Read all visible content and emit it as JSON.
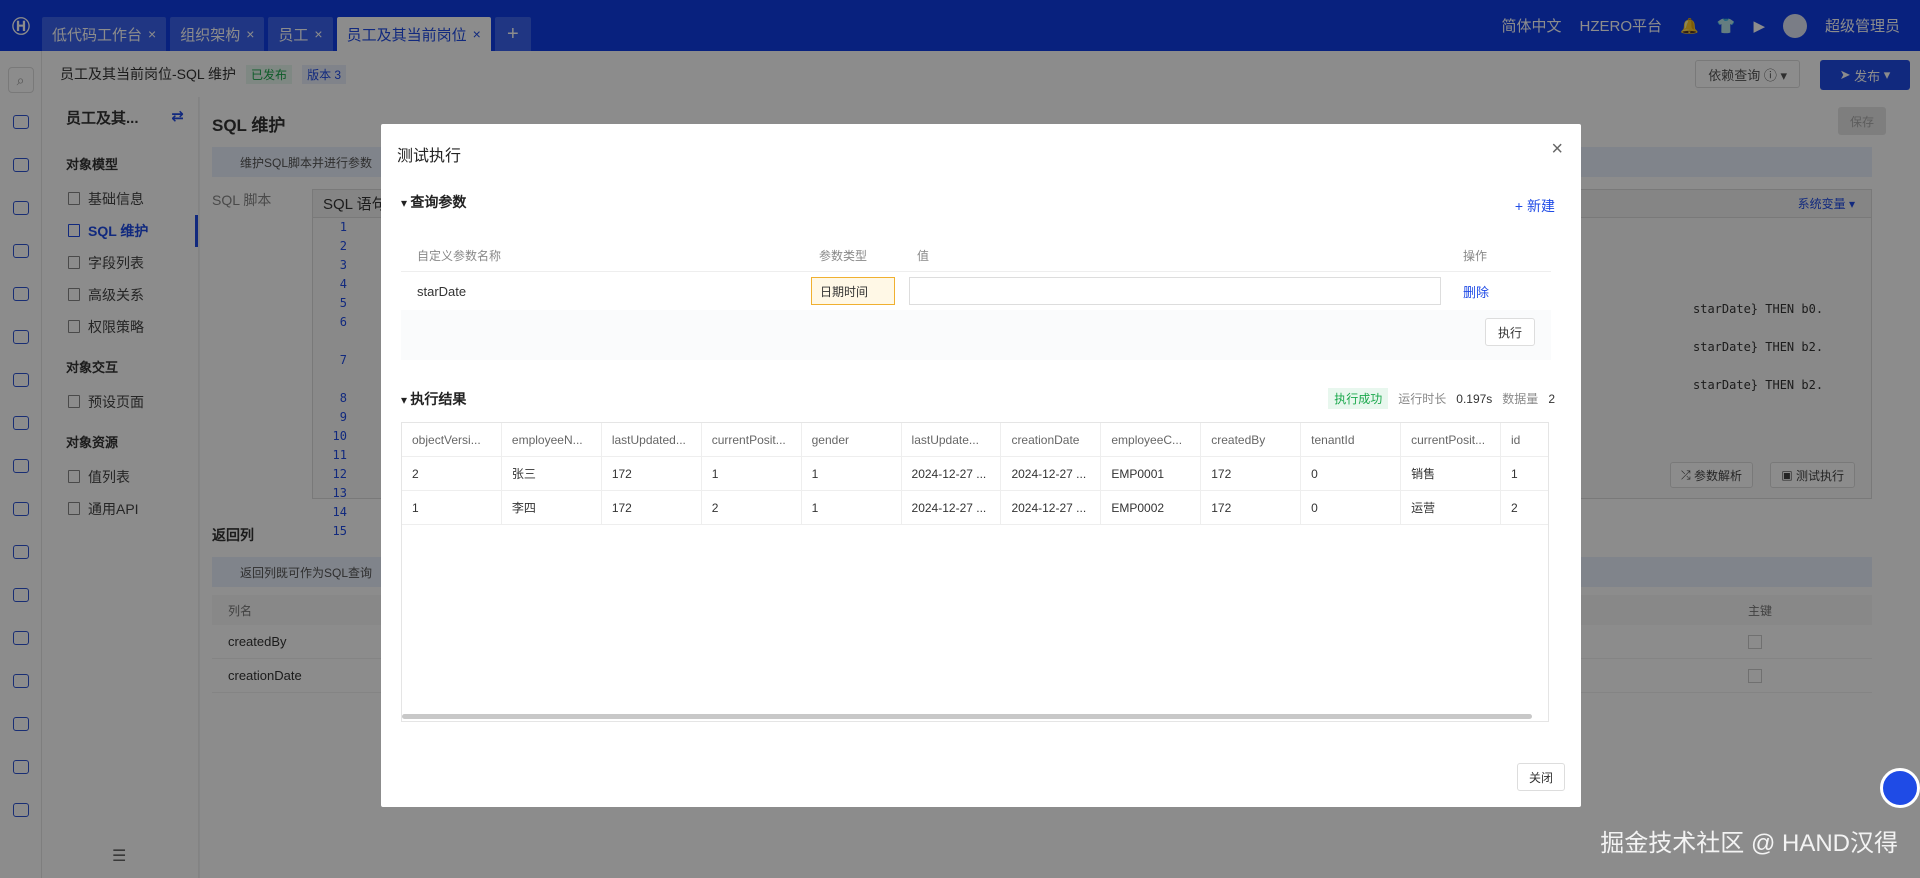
{
  "topbar": {
    "logo": "Ⓗ",
    "tabs": [
      {
        "label": "低代码工作台",
        "active": false
      },
      {
        "label": "组织架构",
        "active": false
      },
      {
        "label": "员工",
        "active": false
      },
      {
        "label": "员工及其当前岗位",
        "active": true
      }
    ],
    "add_tab": "+",
    "close": "×",
    "language": "简体中文",
    "platform": "HZERO平台",
    "user": "超级管理员"
  },
  "header": {
    "title": "员工及其当前岗位-SQL 维护",
    "status_tag": "已发布",
    "version_tag": "版本 3",
    "dep_query": "依赖查询",
    "publish": "发布"
  },
  "leftnav": {
    "title": "员工及其...",
    "groups": [
      {
        "label": "对象模型",
        "items": [
          "基础信息",
          "SQL 维护",
          "字段列表",
          "高级关系",
          "权限策略"
        ]
      },
      {
        "label": "对象交互",
        "items": [
          "预设页面"
        ]
      },
      {
        "label": "对象资源",
        "items": [
          "值列表",
          "通用API"
        ]
      }
    ]
  },
  "main": {
    "title": "SQL 维护",
    "save": "保存",
    "info": "维护SQL脚本并进行参数",
    "sql_label": "SQL 脚本",
    "editor_title": "SQL 语句",
    "sys_var": "系统变量",
    "lines": [
      "1",
      "2",
      "3",
      "4",
      "5",
      "6",
      "7",
      "8",
      "9",
      "10",
      "11",
      "12",
      "13",
      "14",
      "15"
    ],
    "code_frags": [
      "starDate} THEN b0.",
      "starDate} THEN b2.",
      "starDate} THEN b2."
    ],
    "parse_btn": "参数解析",
    "test_btn": "测试执行",
    "return_title": "返回列",
    "return_info": "返回列既可作为SQL查询",
    "return_col_head": "列名",
    "return_pk_head": "主键",
    "return_rows": [
      "createdBy",
      "creationDate"
    ]
  },
  "modal": {
    "title": "测试执行",
    "query_section": "查询参数",
    "new_link": "+ 新建",
    "param_headers": [
      "自定义参数名称",
      "参数类型",
      "值",
      "操作"
    ],
    "param_row": {
      "name": "starDate",
      "type": "日期时间",
      "value": "",
      "action": "删除"
    },
    "execute": "执行",
    "result_section": "执行结果",
    "status": "执行成功",
    "runtime_label": "运行时长",
    "runtime": "0.197s",
    "count_label": "数据量",
    "count": "2",
    "result_headers": [
      "objectVersi...",
      "employeeN...",
      "lastUpdated...",
      "currentPosit...",
      "gender",
      "lastUpdate...",
      "creationDate",
      "employeeC...",
      "createdBy",
      "tenantId",
      "currentPosit...",
      "id"
    ],
    "result_rows": [
      [
        "2",
        "张三",
        "172",
        "1",
        "1",
        "2024-12-27 ...",
        "2024-12-27 ...",
        "EMP0001",
        "172",
        "0",
        "销售",
        "1"
      ],
      [
        "1",
        "李四",
        "172",
        "2",
        "1",
        "2024-12-27 ...",
        "2024-12-27 ...",
        "EMP0002",
        "172",
        "0",
        "运营",
        "2"
      ]
    ],
    "close": "关闭"
  },
  "watermark": "掘金技术社区 @ HAND汉得"
}
